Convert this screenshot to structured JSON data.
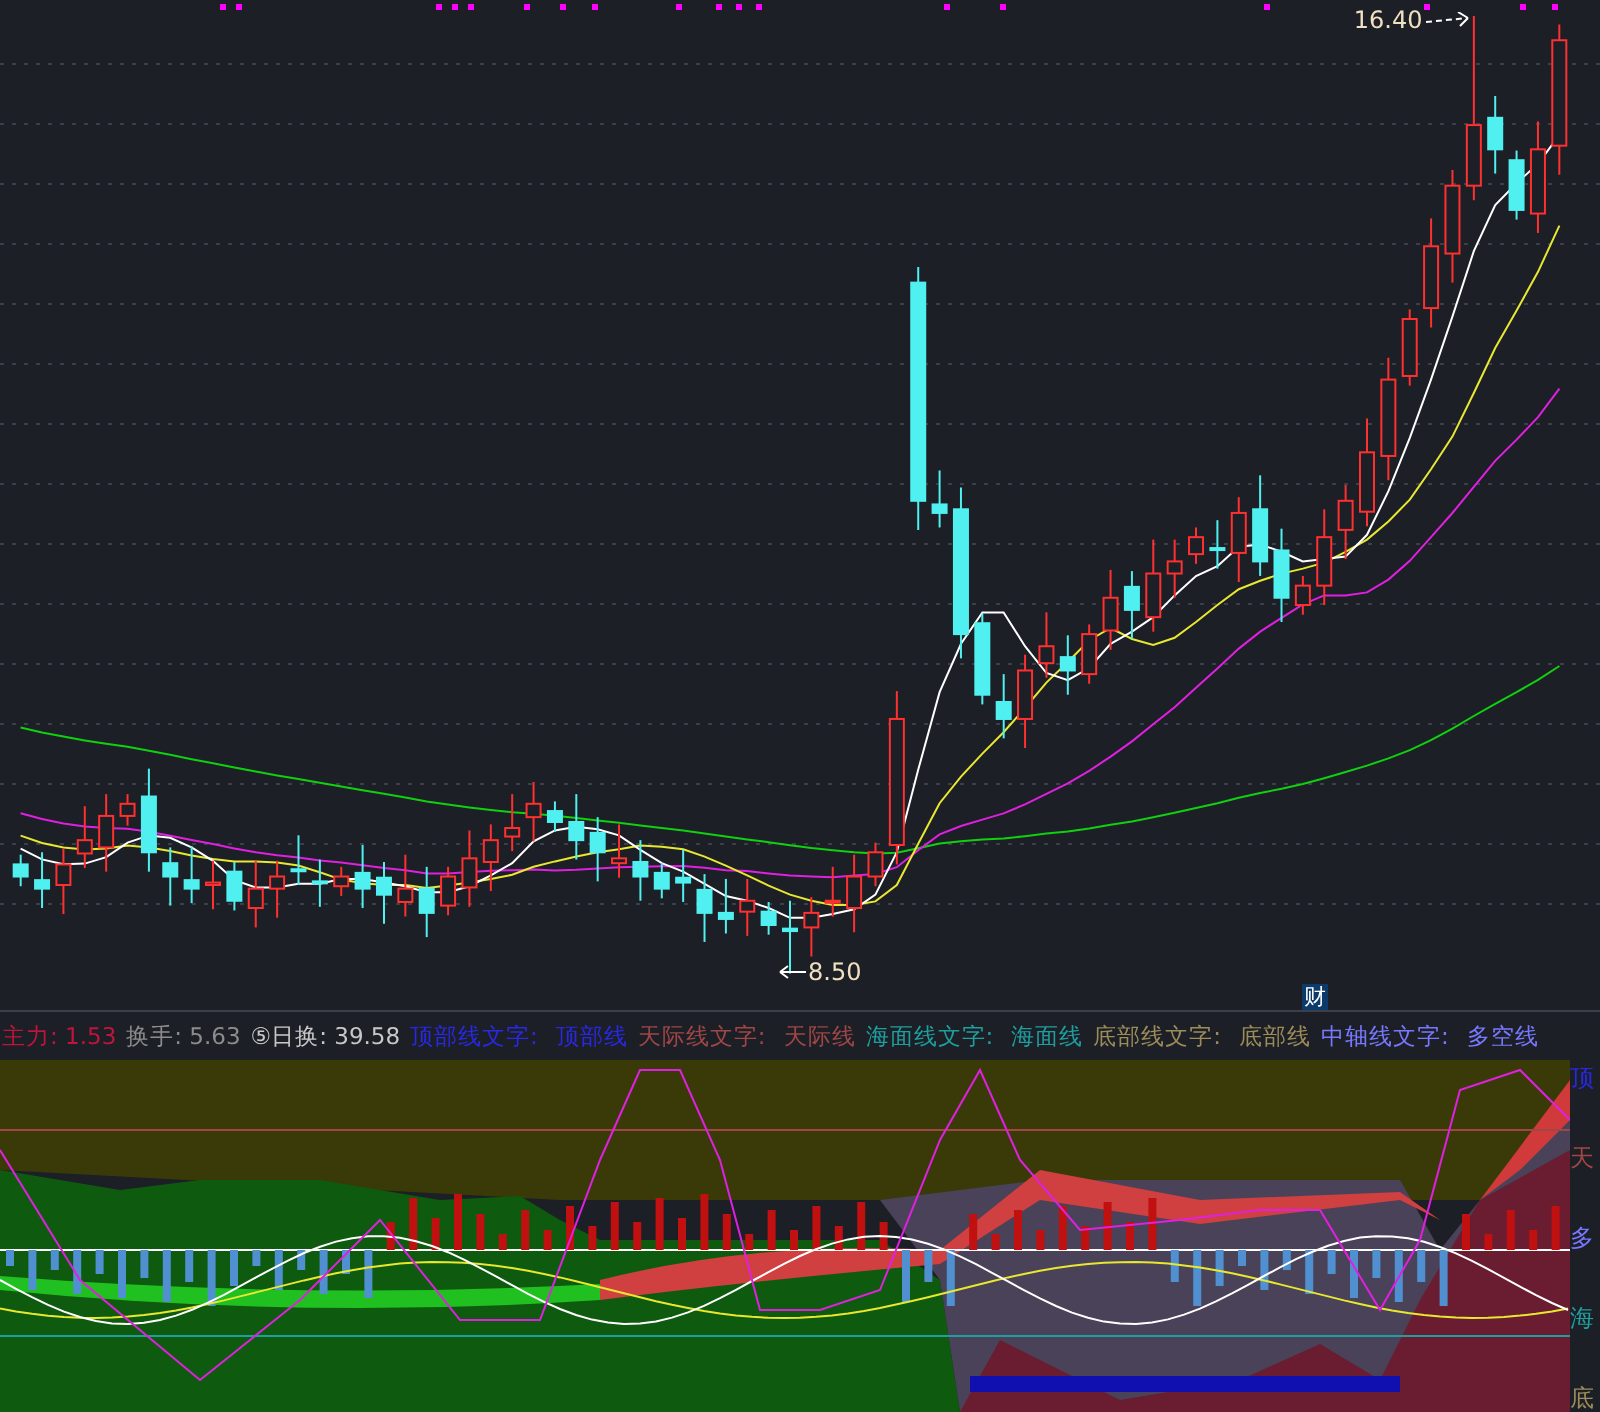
{
  "main_chart": {
    "high_label": "16.40",
    "low_label": "8.50",
    "event_badge": "财"
  },
  "indicator_bar": [
    {
      "text": "主力: 1.53",
      "color": "#c0143c"
    },
    {
      "text": "换手: 5.63",
      "color": "#8c8c8c"
    },
    {
      "text": "⑤日换: 39.58",
      "color": "#c8c8c8"
    },
    {
      "text": "顶部线文字:",
      "color": "#2828e6"
    },
    {
      "text": "顶部线",
      "color": "#2828e6"
    },
    {
      "text": "天际线文字:",
      "color": "#a04646"
    },
    {
      "text": "天际线",
      "color": "#a04646"
    },
    {
      "text": "海面线文字:",
      "color": "#1e9e9e"
    },
    {
      "text": "海面线",
      "color": "#1e9e9e"
    },
    {
      "text": "底部线文字:",
      "color": "#9c8c5a"
    },
    {
      "text": "底部线",
      "color": "#9c8c5a"
    },
    {
      "text": "中轴线文字:",
      "color": "#7878ff"
    },
    {
      "text": "多空线",
      "color": "#7878ff"
    }
  ],
  "indicator_axis": [
    {
      "text": "顶",
      "color": "#2828e6"
    },
    {
      "text": "天",
      "color": "#a04646"
    },
    {
      "text": "多",
      "color": "#7878ff"
    },
    {
      "text": "海",
      "color": "#1e9e9e"
    },
    {
      "text": "底",
      "color": "#9c8c5a"
    }
  ]
}
